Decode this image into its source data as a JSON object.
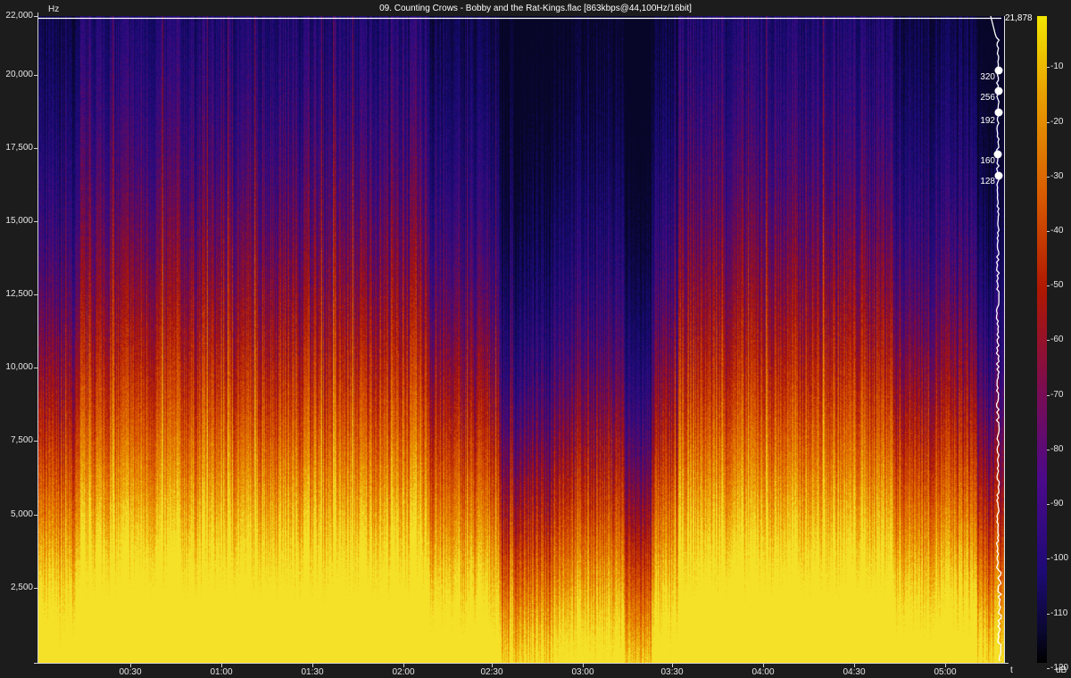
{
  "window": {
    "title": "09. Counting Crows - Bobby and the Rat-Kings.flac [863kbps@44,100Hz/16bit]"
  },
  "axes": {
    "frequency_unit": "Hz",
    "time_unit": "t",
    "level_unit": "dB",
    "frequency_ticks": [
      "22,000",
      "20,000",
      "17,500",
      "15,000",
      "12,500",
      "10,000",
      "7,500",
      "5,000",
      "2,500"
    ],
    "time_ticks": [
      "00:30",
      "01:00",
      "01:30",
      "02:00",
      "02:30",
      "03:00",
      "03:30",
      "04:00",
      "04:30",
      "05:00"
    ],
    "level_ticks": [
      "-10",
      "-20",
      "-30",
      "-40",
      "-50",
      "-60",
      "-70",
      "-80",
      "-90",
      "-100",
      "-110",
      "-120"
    ]
  },
  "spectrum": {
    "cutoff_label": "21,878",
    "bitrate_markers": [
      "320",
      "256",
      "192",
      "160",
      "128"
    ]
  },
  "colors": {
    "background": "#1c1c1c",
    "axis": "#d0d0d0",
    "spectrogram_low": "#0a0830",
    "spectrogram_mid": "#b01800",
    "spectrogram_high": "#f2e600"
  }
}
